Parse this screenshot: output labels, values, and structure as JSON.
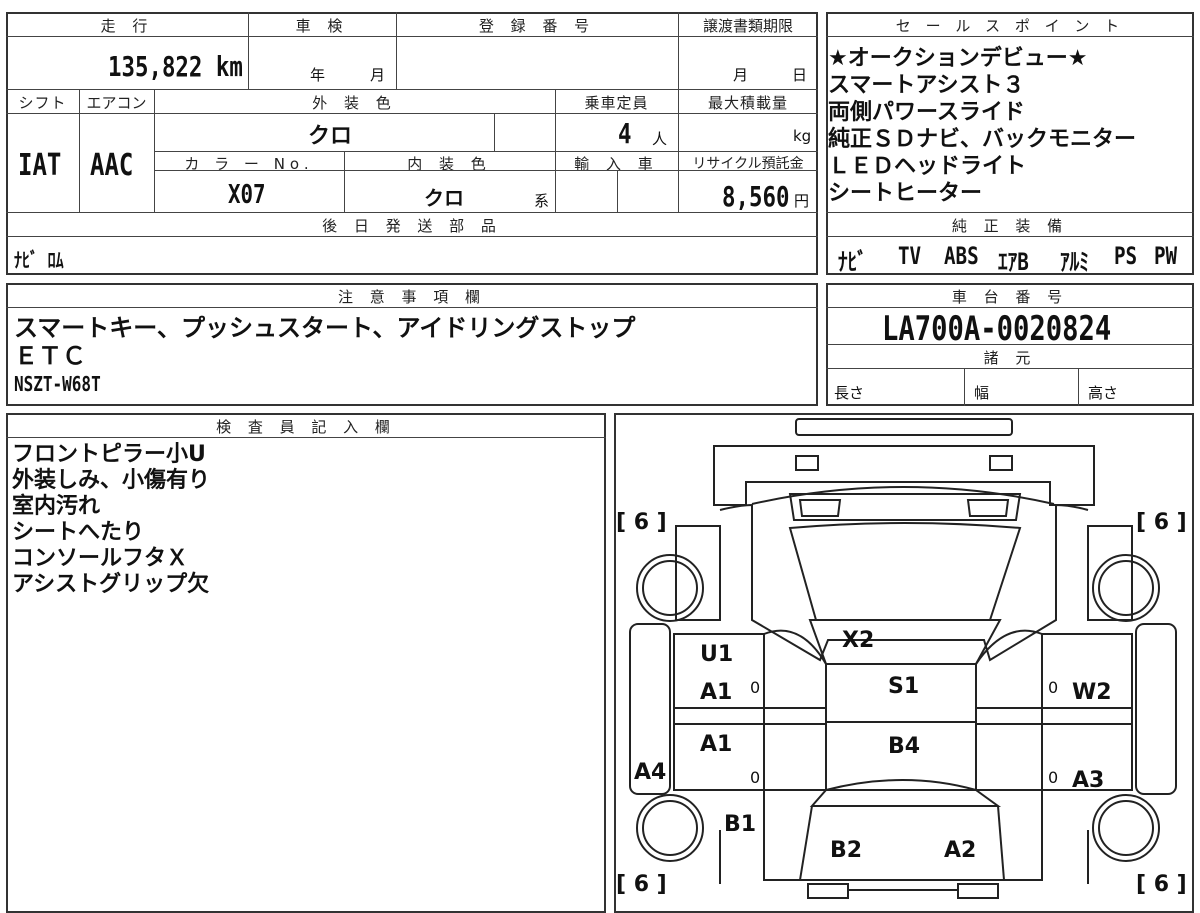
{
  "header": {
    "mileage_label": "走 行",
    "inspection_label": "車 検",
    "registration_label": "登 録 番 号",
    "transfer_deadline_label": "譲渡書類期限",
    "sales_points_label": "セ ー ル ス ポ イ ン ト"
  },
  "mileage": "135,822 km",
  "inspection": {
    "year_label": "年",
    "month_label": "月"
  },
  "transfer": {
    "month_label": "月",
    "day_label": "日"
  },
  "row2": {
    "shift_label": "シフト",
    "aircon_label": "エアコン",
    "exterior_color_label": "外 装 色",
    "capacity_label": "乗車定員",
    "max_load_label": "最大積載量"
  },
  "shift": "IAT",
  "aircon": "AAC",
  "exterior_color": "クロ",
  "capacity": {
    "value": "4",
    "unit": "人"
  },
  "max_load_unit": "kg",
  "row3": {
    "color_no_label": "カ ラ ー No.",
    "interior_color_label": "内 装 色",
    "import_label": "輸 入 車",
    "recycle_label": "リサイクル預託金"
  },
  "color_no": "X07",
  "interior_color": {
    "value": "クロ",
    "suffix": "系"
  },
  "recycle_fee": {
    "value": "8,560",
    "unit": "円"
  },
  "sales_points": [
    "★オークションデビュー★",
    "スマートアシスト３",
    "両側パワースライド",
    "純正ＳＤナビ、バックモニター",
    "ＬＥＤヘッドライト",
    "シートヒーター"
  ],
  "later_parts": {
    "label": "後 日 発 送 部 品",
    "value": "ﾅﾋﾞ ﾛﾑ"
  },
  "equipment": {
    "label": "純 正 装 備",
    "items": [
      "ﾅﾋﾞ",
      "TV",
      "ABS",
      "ｴｱB",
      "ｱﾙﾐ",
      "PS",
      "PW"
    ]
  },
  "notes": {
    "label": "注 意 事 項 欄",
    "lines": [
      "スマートキー、プッシュスタート、アイドリングストップ",
      "ＥＴＣ",
      "NSZT-W68T"
    ]
  },
  "chassis": {
    "label": "車 台 番 号",
    "value": "LA700A-0020824"
  },
  "specs": {
    "label": "諸 元",
    "length": "長さ",
    "width": "幅",
    "height": "高さ"
  },
  "inspector": {
    "label": "検 査 員 記 入 欄",
    "lines": [
      "フロントピラー小U",
      "外装しみ、小傷有り",
      "室内汚れ",
      "シートへたり",
      "コンソールフタＸ",
      "アシストグリップ欠"
    ]
  },
  "diagram": {
    "tire_marks": [
      "[ 6 ]",
      "[ 6 ]",
      "[ 6 ]",
      "[ 6 ]"
    ],
    "labels": [
      "X2",
      "U1",
      "A1",
      "S1",
      "W2",
      "A1",
      "B4",
      "A4",
      "A3",
      "B1",
      "B2",
      "A2"
    ],
    "zeros": [
      "0",
      "0",
      "0",
      "0"
    ]
  }
}
